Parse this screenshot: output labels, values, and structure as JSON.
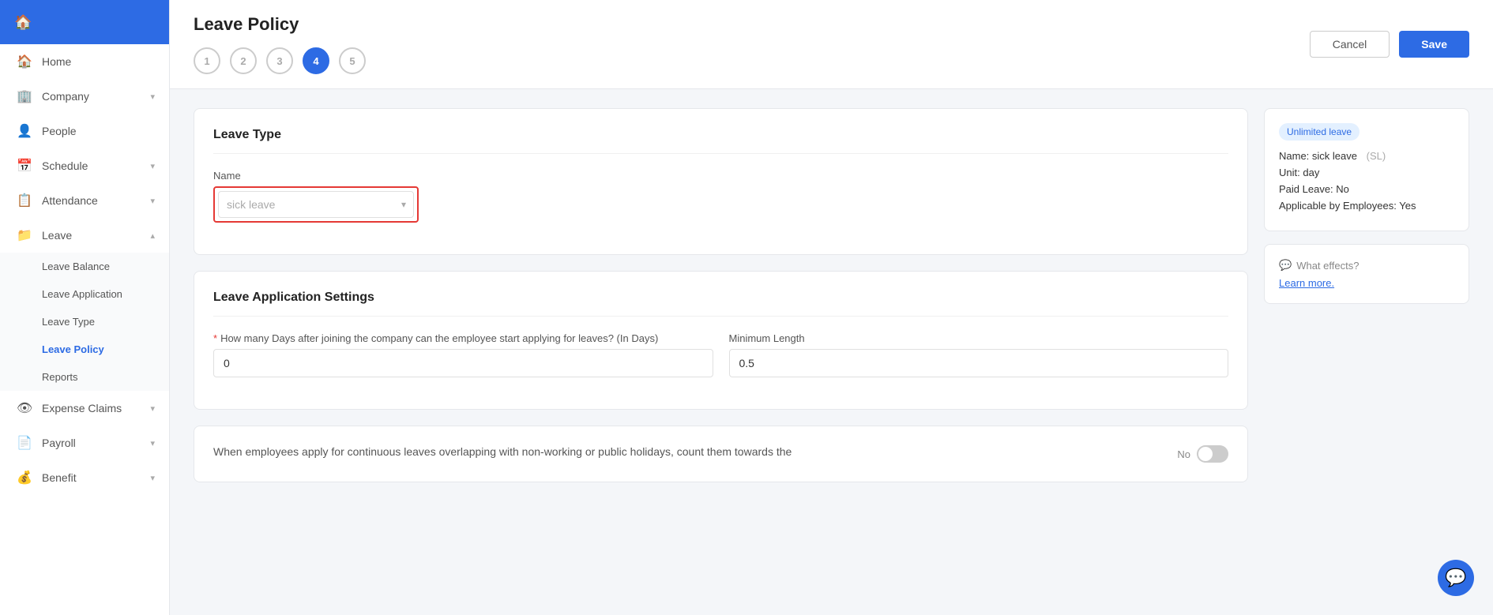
{
  "sidebar": {
    "items": [
      {
        "id": "home",
        "label": "Home",
        "icon": "🏠",
        "hasArrow": false
      },
      {
        "id": "company",
        "label": "Company",
        "icon": "🏢",
        "hasArrow": true
      },
      {
        "id": "people",
        "label": "People",
        "icon": "👤",
        "hasArrow": false
      },
      {
        "id": "schedule",
        "label": "Schedule",
        "icon": "📅",
        "hasArrow": true
      },
      {
        "id": "attendance",
        "label": "Attendance",
        "icon": "📋",
        "hasArrow": true
      },
      {
        "id": "leave",
        "label": "Leave",
        "icon": "📁",
        "hasArrow": true,
        "expanded": true
      }
    ],
    "leave_sub_items": [
      {
        "id": "leave-balance",
        "label": "Leave Balance",
        "active": false
      },
      {
        "id": "leave-application",
        "label": "Leave Application",
        "active": false
      },
      {
        "id": "leave-type",
        "label": "Leave Type",
        "active": false
      },
      {
        "id": "leave-policy",
        "label": "Leave Policy",
        "active": true
      },
      {
        "id": "reports",
        "label": "Reports",
        "active": false
      }
    ],
    "bottom_items": [
      {
        "id": "expense-claims",
        "label": "Expense Claims",
        "icon": "👁",
        "hasArrow": true
      },
      {
        "id": "payroll",
        "label": "Payroll",
        "icon": "📄",
        "hasArrow": true
      },
      {
        "id": "benefit",
        "label": "Benefit",
        "icon": "💰",
        "hasArrow": true
      }
    ]
  },
  "topbar": {
    "title": "Leave Policy",
    "steps": [
      "1",
      "2",
      "3",
      "4",
      "5"
    ],
    "active_step": 4,
    "cancel_label": "Cancel",
    "save_label": "Save"
  },
  "leave_type_section": {
    "title": "Leave Type",
    "name_label": "Name",
    "name_placeholder": "sick leave",
    "name_value": "sick leave"
  },
  "leave_app_settings": {
    "title": "Leave Application Settings",
    "days_label": "How many Days after joining the company can the employee start applying for leaves? (In Days)",
    "days_required": true,
    "days_value": "0",
    "min_length_label": "Minimum Length",
    "min_length_value": "0.5"
  },
  "overlap_section": {
    "text": "When employees apply for continuous leaves overlapping with non-working or public holidays, count them towards the",
    "toggle_label": "No",
    "toggle_on": false
  },
  "info_panel": {
    "badge": "Unlimited leave",
    "name_label": "Name:",
    "name_value": "sick leave",
    "abbr": "(SL)",
    "unit_label": "Unit:",
    "unit_value": "day",
    "paid_label": "Paid Leave:",
    "paid_value": "No",
    "applicable_label": "Applicable by Employees:",
    "applicable_value": "Yes"
  },
  "effects_panel": {
    "icon": "💬",
    "title": "What effects?",
    "link_label": "Learn more."
  }
}
